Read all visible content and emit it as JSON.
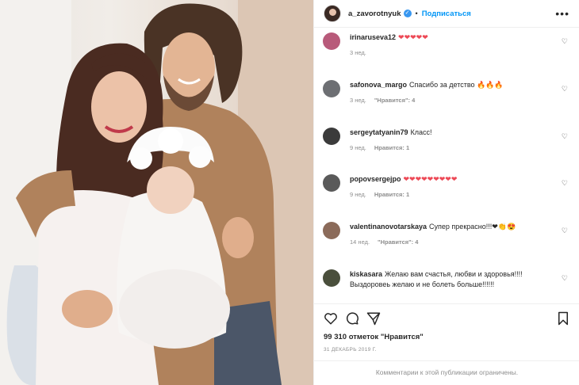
{
  "post": {
    "author": "a_zavorotnyuk",
    "separator": "•",
    "follow_label": "Подписаться",
    "more_icon": "more-horizontal-icon",
    "likes": "99 310 отметок \"Нравится\"",
    "date": "31 ДЕКАБРЬ 2019 Г.",
    "comments_limited": "Комментарии к этой публикации ограничены."
  },
  "comments": [
    {
      "user": "irinaruseva12",
      "text": "❤❤❤❤❤",
      "time": "3 нед.",
      "likes": "",
      "avatar_color": "#b85a7a"
    },
    {
      "user": "safonova_margo",
      "text": "Спасибо за детство 🔥🔥🔥",
      "time": "3 нед.",
      "likes": "\"Нравится\": 4",
      "avatar_color": "#6d6f73"
    },
    {
      "user": "sergeytatyanin79",
      "text": "Класс!",
      "time": "9 нед.",
      "likes": "Нравится: 1",
      "avatar_color": "#3b3b3b"
    },
    {
      "user": "popovsergejpo",
      "text": "❤❤❤❤❤❤❤❤❤",
      "time": "9 нед.",
      "likes": "Нравится: 1",
      "avatar_color": "#5a5a5a"
    },
    {
      "user": "valentinanovotarskaya",
      "text": "Супер прекрасно!!!❤👏😍",
      "time": "14 нед.",
      "likes": "\"Нравится\": 4",
      "avatar_color": "#8b6b5a"
    },
    {
      "user": "kiskasara",
      "text": "Желаю вам счастья, любви и здоровья!!!! Выздоровеь желаю и не болеть больше!!!!!!",
      "time": "",
      "likes": "",
      "avatar_color": "#4a4f3c"
    }
  ],
  "colors": {
    "accent": "#0095f6",
    "verified": "#3897f0",
    "heart_red": "#ed4956",
    "muted": "#8e8e8e"
  }
}
